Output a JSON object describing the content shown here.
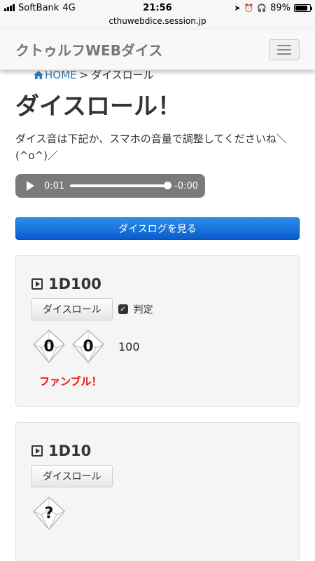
{
  "status_bar": {
    "carrier": "SoftBank",
    "network": "4G",
    "time": "21:56",
    "battery": "89%",
    "battery_level": 0.89
  },
  "browser": {
    "url": "cthuwebdice.session.jp"
  },
  "navbar": {
    "brand": "クトゥルフWEBダイス"
  },
  "breadcrumb": {
    "home": "HOME",
    "separator": ">",
    "current": "ダイスロール"
  },
  "page": {
    "title": "ダイスロール！",
    "description": "ダイス音は下記か、スマホの音量で調整してくださいね＼(^o^)／"
  },
  "audio": {
    "elapsed": "0:01",
    "remaining": "-0:00",
    "progress": 1.0
  },
  "log_button": "ダイスログを見る",
  "panels": [
    {
      "title": "1D100",
      "roll_label": "ダイスロール",
      "check_label": "判定",
      "checked": true,
      "dice": [
        "0",
        "0"
      ],
      "total": "100",
      "result": "ファンブル！"
    },
    {
      "title": "1D10",
      "roll_label": "ダイスロール",
      "dice": [
        "?"
      ]
    }
  ],
  "colors": {
    "primary": "#0a5bcd",
    "fumble": "#ee1111",
    "link": "#337ab7"
  }
}
